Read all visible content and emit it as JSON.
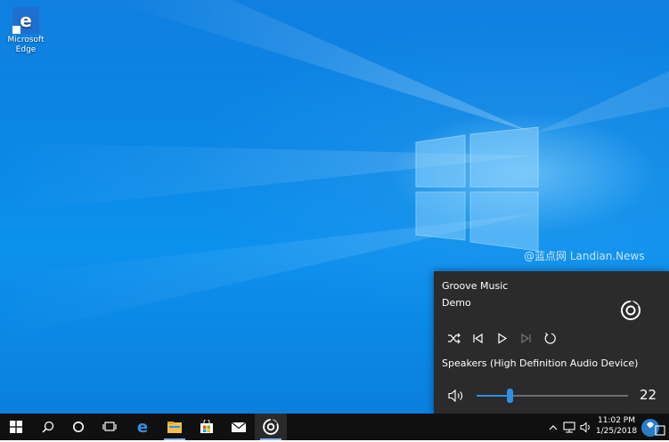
{
  "desktop": {
    "icons": [
      {
        "label": "Microsoft Edge",
        "icon": "edge-icon"
      }
    ],
    "watermark": "@蓝点网 Landian.News"
  },
  "flyout": {
    "app_name": "Groove Music",
    "track_title": "Demo",
    "device": "Speakers (High Definition Audio Device)",
    "volume": 22,
    "volume_fraction": 0.22,
    "controls": [
      "shuffle-icon",
      "previous-icon",
      "play-icon",
      "next-icon",
      "repeat-icon"
    ],
    "accent": "#2f8fe6",
    "background": "#2b2b2b"
  },
  "taskbar": {
    "buttons": [
      "start-icon",
      "search-icon",
      "cortana-icon",
      "task-view-icon",
      "edge-icon",
      "file-explorer-icon",
      "store-icon",
      "mail-icon",
      "groove-music-icon"
    ],
    "tray": [
      "show-hidden-icons-chevron",
      "network-icon",
      "volume-icon"
    ],
    "clock_time": "11:02 PM",
    "clock_date": "1/25/2018",
    "background": "#101010"
  }
}
